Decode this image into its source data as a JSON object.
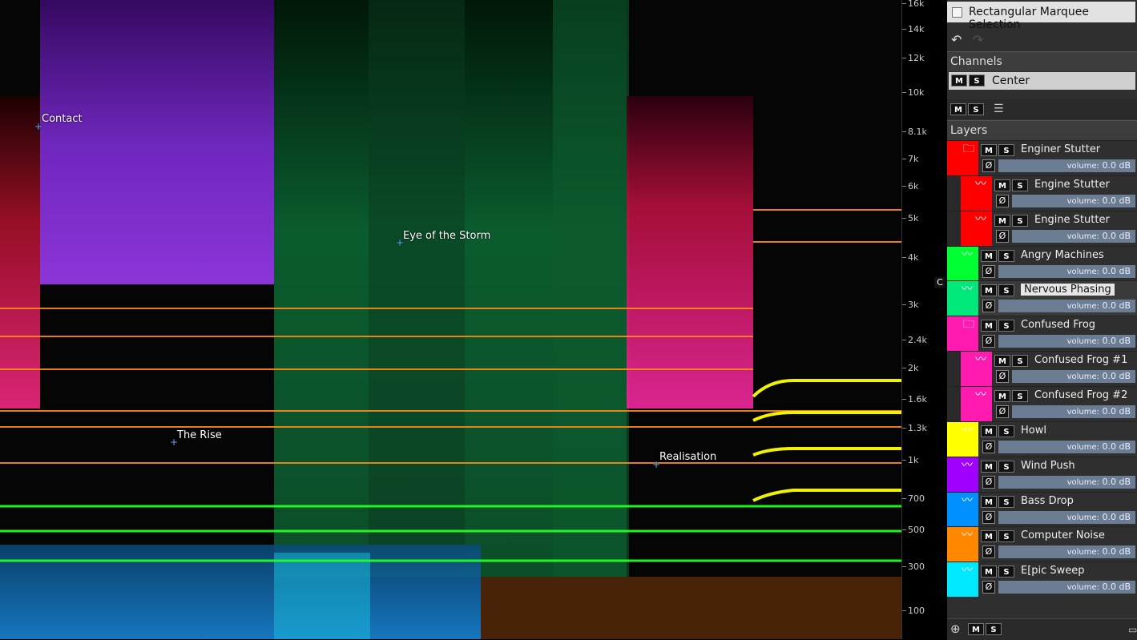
{
  "spectrogram": {
    "markers": [
      {
        "label": "Contact"
      },
      {
        "label": "Eye of the Storm"
      },
      {
        "label": "The Rise"
      },
      {
        "label": "Realisation"
      }
    ]
  },
  "frequency_axis": {
    "ticks": [
      "16k",
      "14k",
      "12k",
      "10k",
      "8.1k",
      "7k",
      "6k",
      "5k",
      "4k",
      "3k",
      "2.4k",
      "2k",
      "1.6k",
      "1.3k",
      "1k",
      "700",
      "500",
      "300",
      "100"
    ]
  },
  "channel_marker": "C",
  "panel": {
    "marquee_label": "Rectangular Marquee Selection",
    "channels_title": "Channels",
    "channel_name": "Center",
    "layers_title": "Layers",
    "mute_label": "M",
    "solo_label": "S",
    "layers": [
      {
        "name": "Enginer Stutter",
        "volume_label": "volume:",
        "volume": "0.0 dB",
        "color": "#ff0000",
        "icon": "folder-icon",
        "indent": 0
      },
      {
        "name": "Engine Stutter",
        "volume_label": "volume:",
        "volume": "0.0 dB",
        "color": "#ff0000",
        "icon": "waveform-icon",
        "indent": 1
      },
      {
        "name": "Engine Stutter",
        "volume_label": "volume:",
        "volume": "0.0 dB",
        "color": "#ff0000",
        "icon": "waveform-icon",
        "indent": 1
      },
      {
        "name": "Angry Machines",
        "volume_label": "volume:",
        "volume": "0.0 dB",
        "color": "#00ff33",
        "icon": "waveform-icon",
        "indent": 0
      },
      {
        "name": "Nervous Phasing",
        "volume_label": "volume:",
        "volume": "0.0 dB",
        "color": "#00e87a",
        "icon": "waveform-icon",
        "indent": 0
      },
      {
        "name": "Confused Frog",
        "volume_label": "volume:",
        "volume": "0.0 dB",
        "color": "#ff1ab0",
        "icon": "folder-icon",
        "indent": 0
      },
      {
        "name": "Confused Frog #1",
        "volume_label": "volume:",
        "volume": "0.0 dB",
        "color": "#ff1ab0",
        "icon": "waveform-icon",
        "indent": 1
      },
      {
        "name": "Confused Frog #2",
        "volume_label": "volume:",
        "volume": "0.0 dB",
        "color": "#ff1ab0",
        "icon": "waveform-icon",
        "indent": 1
      },
      {
        "name": "Howl",
        "volume_label": "volume:",
        "volume": "0.0 dB",
        "color": "#ffff00",
        "icon": "waveform-icon",
        "indent": 0
      },
      {
        "name": "Wind Push",
        "volume_label": "volume:",
        "volume": "0.0 dB",
        "color": "#a000ff",
        "icon": "waveform-icon",
        "indent": 0
      },
      {
        "name": "Bass Drop",
        "volume_label": "volume:",
        "volume": "0.0 dB",
        "color": "#0090ff",
        "icon": "waveform-icon",
        "indent": 0
      },
      {
        "name": "Computer Noise",
        "volume_label": "volume:",
        "volume": "0.0 dB",
        "color": "#ff8800",
        "icon": "waveform-icon",
        "indent": 0
      },
      {
        "name": "E[pic Sweep",
        "volume_label": "volume:",
        "volume": "0.0 dB",
        "color": "#00e8ff",
        "icon": "waveform-icon",
        "indent": 0
      }
    ]
  }
}
